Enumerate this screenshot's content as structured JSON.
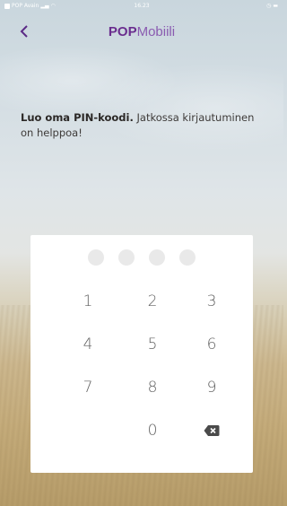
{
  "status_bar": {
    "carrier": "POP Avain",
    "time": "16.23"
  },
  "header": {
    "title_bold": "POP",
    "title_light": "Mobiili"
  },
  "intro": {
    "bold": "Luo oma PIN-koodi.",
    "rest": " Jatkossa kirjautuminen on helppoa!"
  },
  "pin": {
    "length": 4,
    "entered": 0
  },
  "keypad": {
    "row1": [
      "1",
      "2",
      "3"
    ],
    "row2": [
      "4",
      "5",
      "6"
    ],
    "row3": [
      "7",
      "8",
      "9"
    ],
    "zero": "0",
    "delete_icon": "backspace-icon"
  }
}
